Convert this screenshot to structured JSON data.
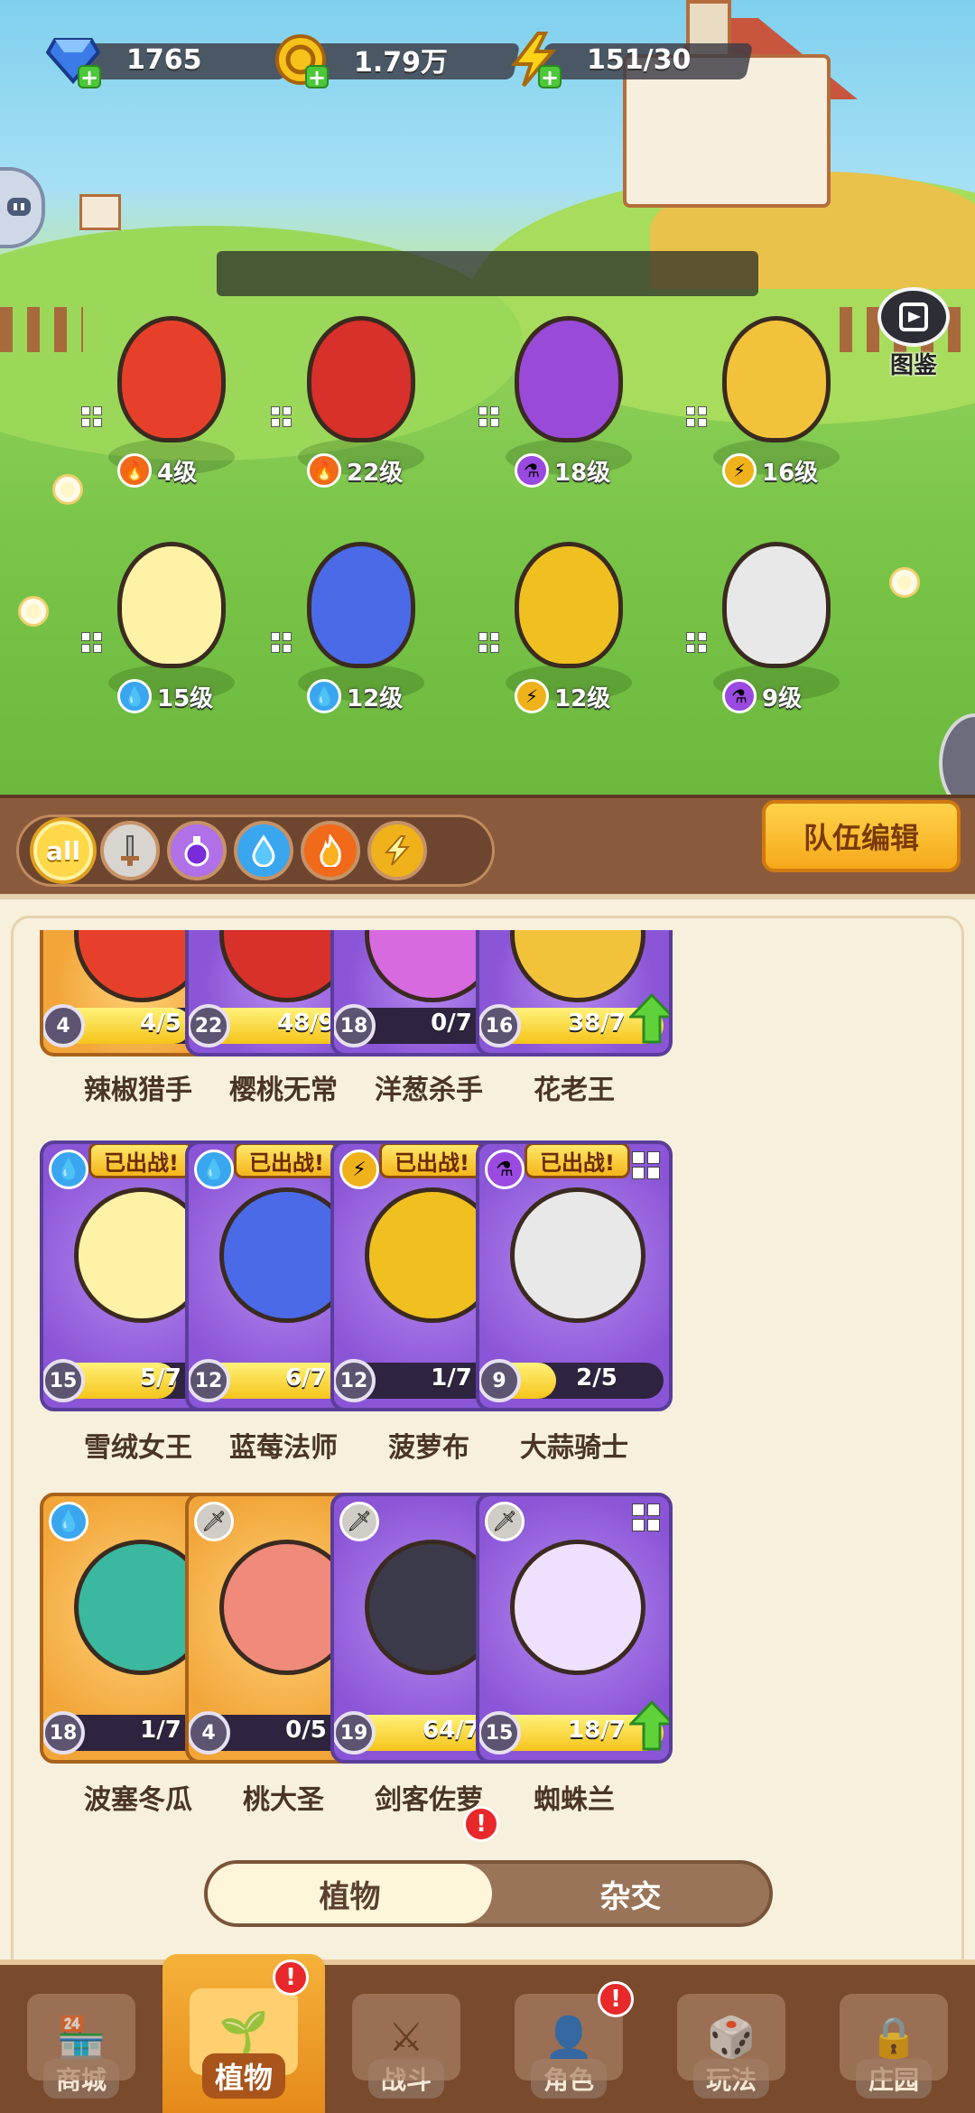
{
  "resources": {
    "gems": "1765",
    "coins": "1.79万",
    "energy": "151/30"
  },
  "scene": {
    "tujian_label": "图鉴"
  },
  "team": [
    {
      "level": "4级",
      "element": "fire"
    },
    {
      "level": "22级",
      "element": "fire"
    },
    {
      "level": "18级",
      "element": "poison"
    },
    {
      "level": "16级",
      "element": "lightning"
    },
    {
      "level": "15级",
      "element": "water"
    },
    {
      "level": "12级",
      "element": "water"
    },
    {
      "level": "12级",
      "element": "lightning"
    },
    {
      "level": "9级",
      "element": "poison"
    }
  ],
  "filters": {
    "all_label": "all",
    "team_edit_label": "队伍编辑"
  },
  "cards": [
    {
      "name": "辣椒猎手",
      "level": "4",
      "progress": "4/5",
      "style": "orange"
    },
    {
      "name": "樱桃无常",
      "level": "22",
      "progress": "48/9",
      "style": "purple",
      "upgrade": true
    },
    {
      "name": "洋葱杀手",
      "level": "18",
      "progress": "0/7",
      "style": "purple"
    },
    {
      "name": "花老王",
      "level": "16",
      "progress": "38/7",
      "style": "purple",
      "upgrade": true
    },
    {
      "name": "雪绒女王",
      "level": "15",
      "progress": "5/7",
      "style": "purple",
      "deployed": "已出战!",
      "element": "water"
    },
    {
      "name": "蓝莓法师",
      "level": "12",
      "progress": "6/7",
      "style": "purple",
      "deployed": "已出战!",
      "element": "water"
    },
    {
      "name": "菠萝布",
      "level": "12",
      "progress": "1/7",
      "style": "purple",
      "deployed": "已出战!",
      "element": "lightning"
    },
    {
      "name": "大蒜骑士",
      "level": "9",
      "progress": "2/5",
      "style": "purple",
      "deployed": "已出战!",
      "element": "poison"
    },
    {
      "name": "波塞冬瓜",
      "level": "18",
      "progress": "1/7",
      "style": "orange",
      "element": "water"
    },
    {
      "name": "桃大圣",
      "level": "4",
      "progress": "0/5",
      "style": "orange",
      "element": "sword"
    },
    {
      "name": "剑客佐萝",
      "level": "19",
      "progress": "64/7",
      "style": "purple",
      "element": "sword",
      "upgrade": true
    },
    {
      "name": "蜘蛛兰",
      "level": "15",
      "progress": "18/7",
      "style": "purple",
      "element": "sword",
      "upgrade": true
    }
  ],
  "toggle": {
    "plants": "植物",
    "hybrid": "杂交",
    "alert": "!"
  },
  "nav": [
    {
      "label": "商城"
    },
    {
      "label": "植物",
      "active": true,
      "alert": "!"
    },
    {
      "label": "战斗"
    },
    {
      "label": "角色",
      "alert": "!"
    },
    {
      "label": "玩法"
    },
    {
      "label": "庄园"
    }
  ]
}
